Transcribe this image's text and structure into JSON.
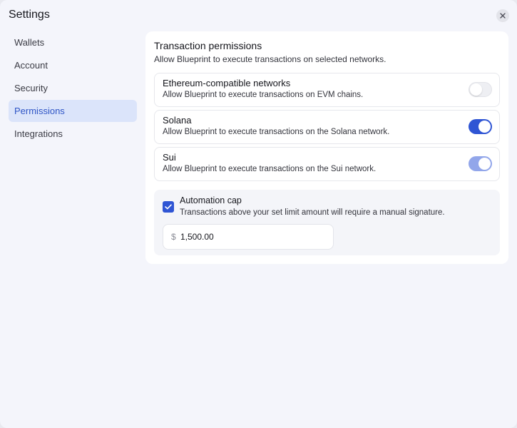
{
  "window": {
    "title": "Settings",
    "close_icon": "close-icon"
  },
  "sidebar": {
    "items": [
      {
        "label": "Wallets",
        "active": false
      },
      {
        "label": "Account",
        "active": false
      },
      {
        "label": "Security",
        "active": false
      },
      {
        "label": "Permissions",
        "active": true
      },
      {
        "label": "Integrations",
        "active": false
      }
    ]
  },
  "main": {
    "title": "Transaction permissions",
    "description": "Allow Blueprint to execute transactions on selected networks.",
    "networks": [
      {
        "name": "Ethereum-compatible networks",
        "description": "Allow Blueprint to execute transactions on EVM chains.",
        "enabled": false
      },
      {
        "name": "Solana",
        "description": "Allow Blueprint to execute transactions on the Solana network.",
        "enabled": true
      },
      {
        "name": "Sui",
        "description": "Allow Blueprint to execute transactions on the Sui network.",
        "enabled": true
      }
    ],
    "automation_cap": {
      "checked": true,
      "title": "Automation cap",
      "description": "Transactions above your set limit amount will require a manual signature.",
      "currency_symbol": "$",
      "amount": "1,500.00"
    }
  },
  "colors": {
    "accent": "#2f55d4",
    "accent_light": "#92a6ea",
    "nav_active_bg": "#dbe4fa"
  }
}
